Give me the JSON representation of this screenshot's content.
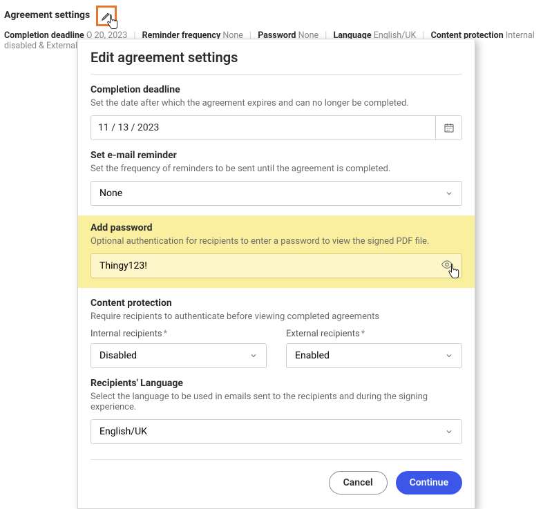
{
  "header": {
    "title": "Agreement settings",
    "meta": {
      "completion_deadline_label": "Completion deadline",
      "completion_deadline_value": "O       20, 2023",
      "reminder_label": "Reminder frequency",
      "reminder_value": "None",
      "password_label": "Password",
      "password_value": "None",
      "language_label": "Language",
      "language_value": "English/UK",
      "content_protection_label": "Content protection",
      "content_protection_value": "Internal disabled & External enabled"
    }
  },
  "modal": {
    "title": "Edit agreement settings",
    "deadline": {
      "heading": "Completion deadline",
      "desc": "Set the date after which the agreement expires and can no longer be completed.",
      "value": "11 / 13 / 2023"
    },
    "reminder": {
      "heading": "Set e-mail reminder",
      "desc": "Set the frequency of reminders to be sent until the agreement is completed.",
      "value": "None"
    },
    "password": {
      "heading": "Add password",
      "desc": "Optional authentication for recipients to enter a password to view the signed PDF file.",
      "value": "Thingy123!"
    },
    "protection": {
      "heading": "Content protection",
      "desc": "Require recipients to authenticate before viewing completed agreements",
      "internal_label": "Internal recipients",
      "internal_value": "Disabled",
      "external_label": "External recipients",
      "external_value": "Enabled"
    },
    "language": {
      "heading": "Recipients' Language",
      "desc": "Select the language to be used in emails sent to the recipients and during the signing experience.",
      "value": "English/UK"
    },
    "buttons": {
      "cancel": "Cancel",
      "continue": "Continue"
    }
  }
}
